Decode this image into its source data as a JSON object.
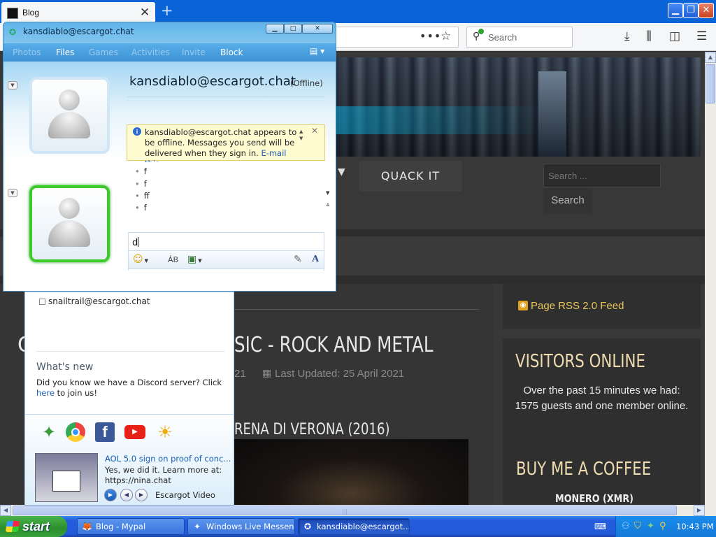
{
  "browser": {
    "tab_title": "Blog",
    "tab_close": "✕",
    "new_tab": "+",
    "search_placeholder": "Search",
    "window_buttons": {
      "minimize": "▁",
      "restore": "❐",
      "close": "✕"
    }
  },
  "page": {
    "menu_dropdown_arrow": "▼",
    "menu_quack": "QUACK IT",
    "site_search_placeholder": "Search ...",
    "site_search_button": "Search",
    "article_title_start": "C",
    "article_title": "SIC - ROCK AND METAL",
    "article_meta_date": "21",
    "article_meta_updated": "Last Updated: 25 April 2021",
    "article_subtitle": "RENA DI VERONA (2016)",
    "rss_label": "Page RSS 2.0 Feed",
    "visitors_title": "VISITORS ONLINE",
    "visitors_text": "Over the past 15 minutes we had: 1575 guests and one member online.",
    "coffee_title": "BUY ME A COFFEE",
    "monero_label": "MONERO (XMR)"
  },
  "messenger": {
    "contact_list": {
      "contact": "snailtrail@escargot.chat",
      "whats_new_title": "What's new",
      "whats_new_text": "Did you know we have a Discord server? Click ",
      "whats_new_link": "here",
      "whats_new_text_end": " to join us!",
      "video_title": "AOL 5.0 sign on proof of conc...",
      "video_desc": "Yes, we did it. Learn more at: https://nina.chat",
      "video_label": "Escargot Video"
    },
    "conversation": {
      "window_title": "kansdiablo@escargot.chat",
      "toolbar": {
        "photos": "Photos",
        "files": "Files",
        "games": "Games",
        "activities": "Activities",
        "invite": "Invite",
        "block": "Block"
      },
      "contact_name": "kansdiablo@escargot.chat",
      "contact_status": "(Offline)",
      "alert_text": "kansdiablo@escargot.chat appears to be offline. Messages you send will be delivered when they sign in. ",
      "alert_link": "E-mail this",
      "messages": [
        "f",
        "f",
        "ff",
        "f"
      ],
      "composer_text": "d"
    }
  },
  "taskbar": {
    "start_label": "start",
    "tasks": [
      {
        "label": "Blog - Mypal",
        "icon": "browser-icon"
      },
      {
        "label": "Windows Live Messen...",
        "icon": "messenger-icon"
      },
      {
        "label": "kansdiablo@escargot....",
        "icon": "conversation-icon"
      }
    ],
    "clock": "10:43 PM"
  },
  "colors": {
    "taskbar_blue": "#245ddc",
    "start_green": "#2b8f2b",
    "messenger_blue": "#5fb4ea",
    "page_dark": "#383838",
    "heading_cream": "#eedcb0",
    "rss_gold": "#e8c65a"
  }
}
